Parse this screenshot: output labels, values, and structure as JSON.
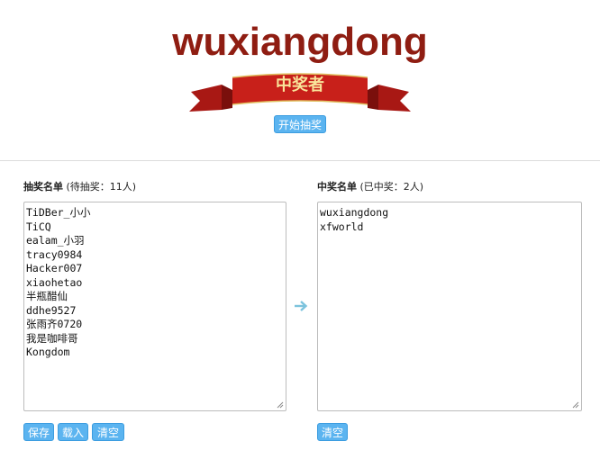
{
  "header": {
    "winner_name": "wuxiangdong",
    "ribbon_label": "中奖者",
    "start_button": "开始抽奖"
  },
  "left_panel": {
    "title": "抽奖名单",
    "subtitle": "(待抽奖：11人)",
    "names": [
      "TiDBer_小小",
      "TiCQ",
      "ealam_小羽",
      "tracy0984",
      "Hacker007",
      "xiaohetao",
      "半瓶醋仙",
      "ddhe9527",
      "张雨齐0720",
      "我是咖啡哥",
      "Kongdom"
    ],
    "buttons": {
      "save": "保存",
      "load": "载入",
      "clear": "清空"
    }
  },
  "right_panel": {
    "title": "中奖名单",
    "subtitle": "(已中奖：2人)",
    "names": [
      "wuxiangdong",
      "xfworld"
    ],
    "buttons": {
      "clear": "清空"
    }
  },
  "icons": {
    "transfer": "arrow-right-icon",
    "resize": "resize-grip-icon"
  },
  "colors": {
    "winner": "#8f1d12",
    "ribbon": "#c8201a",
    "ribbon_text": "#f9e49a",
    "button": "#5bb4f0",
    "arrow": "#7cc3dd"
  }
}
